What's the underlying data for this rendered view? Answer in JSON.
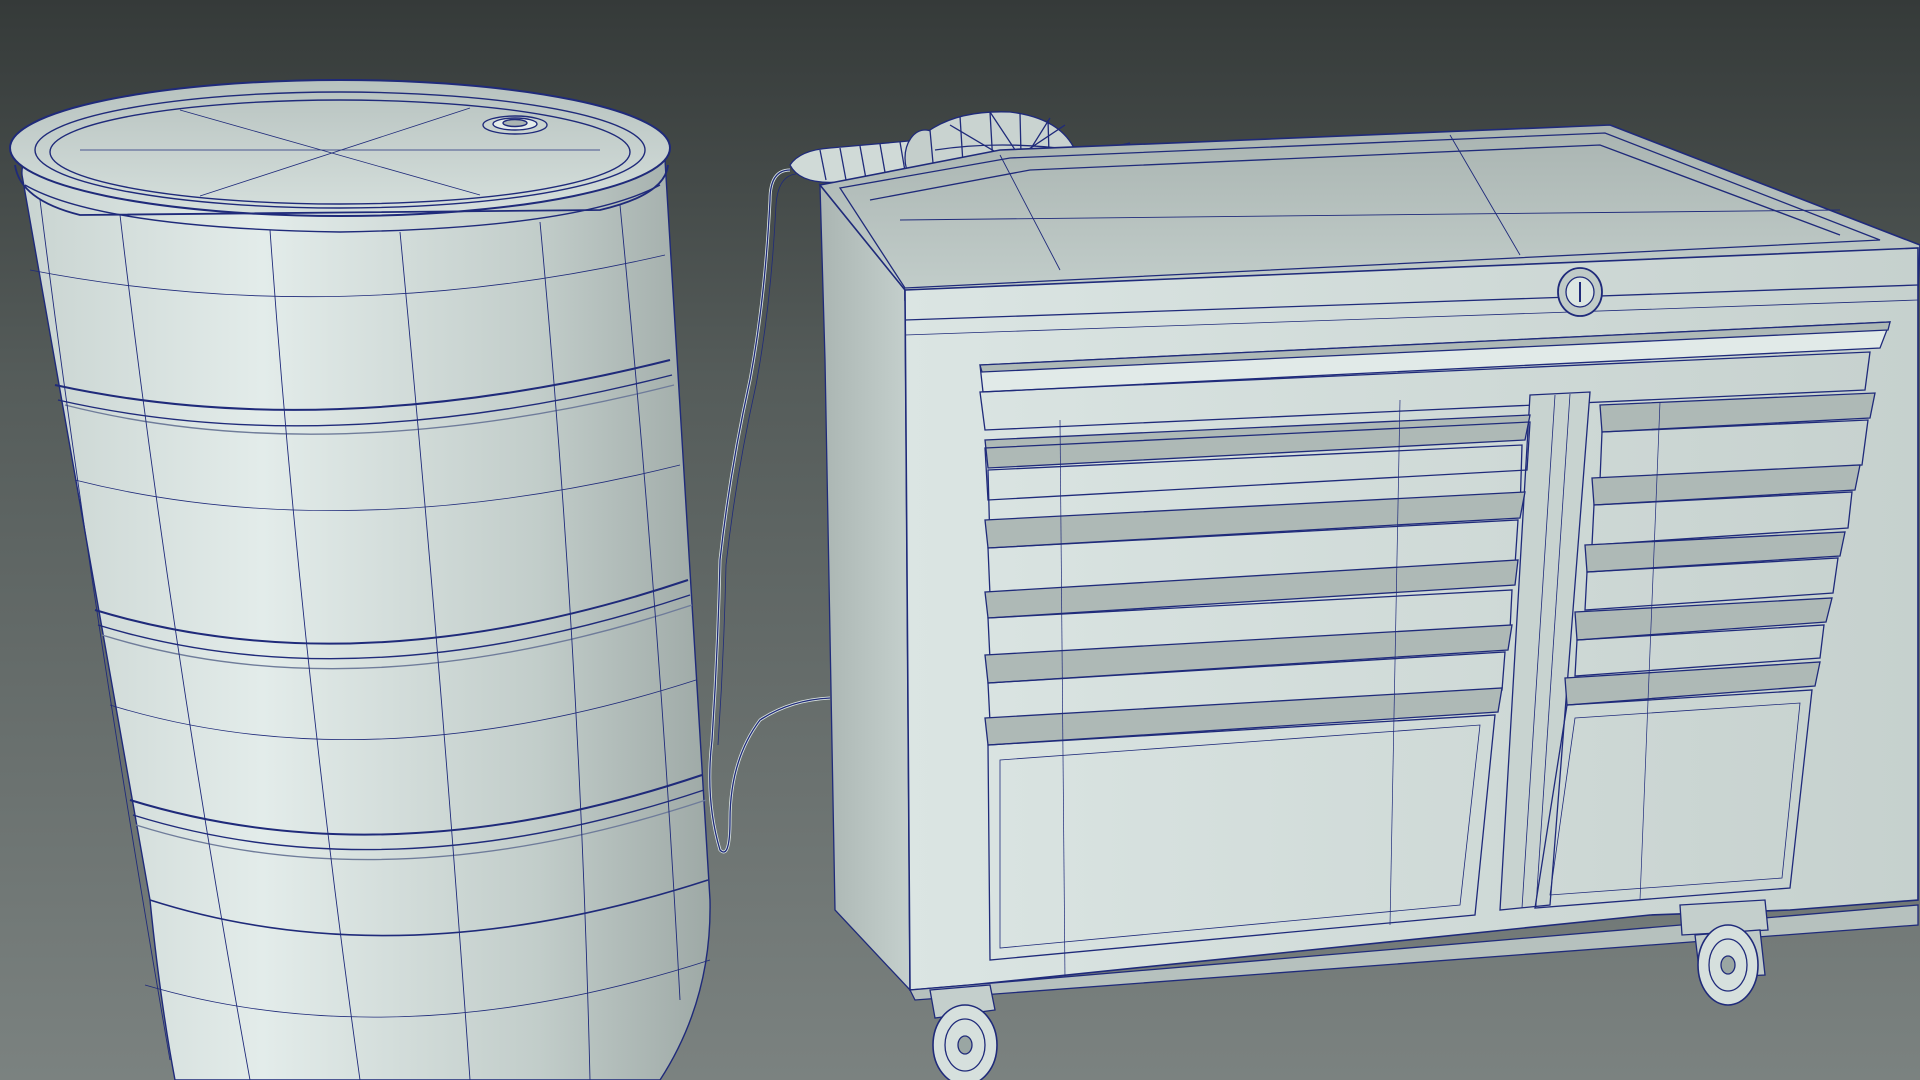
{
  "scene": {
    "description_visible_text": [],
    "colors": {
      "background_top": "#363b3a",
      "background_bottom": "#7a807e",
      "model_shade_light": "#dfe9e7",
      "model_shade_mid": "#b9c6c3",
      "model_shade_dark": "#8f9b98",
      "wireframe": "#1f2a7a"
    },
    "objects": [
      {
        "name": "oil-drum",
        "parts": [
          "drum-lid",
          "drum-bung-cap",
          "drum-rib",
          "drum-body"
        ]
      },
      {
        "name": "work-lamp",
        "parts": [
          "lamp-cage",
          "lamp-handle",
          "lamp-cord"
        ]
      },
      {
        "name": "tool-cabinet",
        "parts": [
          "cabinet-top",
          "cabinet-lock",
          "cabinet-left-drawers",
          "cabinet-right-drawers",
          "cabinet-side-panel",
          "caster-wheel"
        ]
      }
    ],
    "cabinet": {
      "left_drawer_count": 6,
      "right_drawer_count": 6
    },
    "drum": {
      "rib_count": 4
    }
  }
}
